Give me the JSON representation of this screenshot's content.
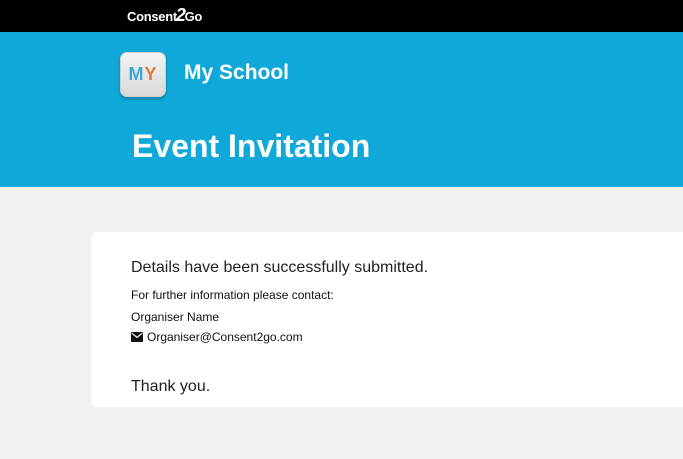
{
  "topbar": {
    "brand_prefix": "Consent",
    "brand_two": "2",
    "brand_suffix": "Go"
  },
  "header": {
    "badge_m": "M",
    "badge_y": "Y",
    "school_name": "My School",
    "page_title": "Event Invitation",
    "color": "#0fa8d8"
  },
  "card": {
    "success_message": "Details have been successfully submitted.",
    "contact_intro": "For further information please contact:",
    "organiser_name": "Organiser Name",
    "organiser_email": "Organiser@Consent2go.com",
    "email_icon": "envelope-icon",
    "thanks": "Thank you."
  }
}
